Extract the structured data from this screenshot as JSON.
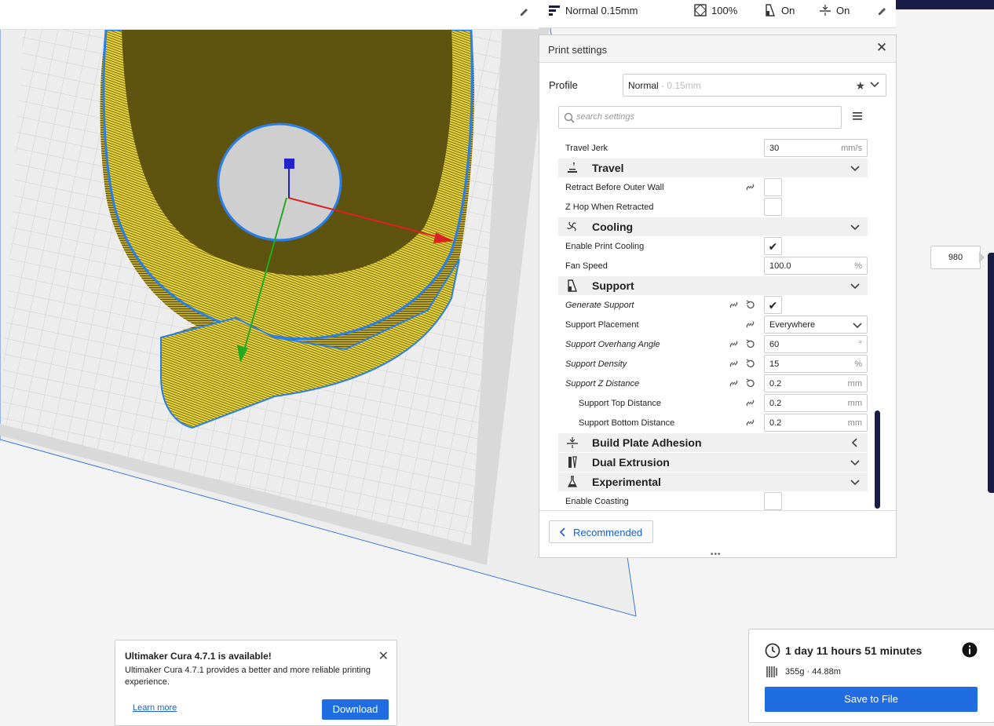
{
  "summary": {
    "profile": "Normal 0.15mm",
    "infill": "100%",
    "support": "On",
    "adhesion": "On"
  },
  "panel": {
    "title": "Print settings",
    "profile_label": "Profile",
    "profile_name": "Normal",
    "profile_sub": " - 0.15mm",
    "search_placeholder": "search settings",
    "recommended_label": "Recommended"
  },
  "settings": {
    "travel_jerk": {
      "label": "Travel Jerk",
      "value": "30",
      "unit": "mm/s"
    },
    "travel": {
      "label": "Travel"
    },
    "retract_outer": {
      "label": "Retract Before Outer Wall"
    },
    "zhop": {
      "label": "Z Hop When Retracted"
    },
    "cooling": {
      "label": "Cooling"
    },
    "enable_cooling": {
      "label": "Enable Print Cooling",
      "check": "✔"
    },
    "fan_speed": {
      "label": "Fan Speed",
      "value": "100.0",
      "unit": "%"
    },
    "support": {
      "label": "Support"
    },
    "generate_support": {
      "label": "Generate Support",
      "check": "✔"
    },
    "support_placement": {
      "label": "Support Placement",
      "value": "Everywhere"
    },
    "overhang_angle": {
      "label": "Support Overhang Angle",
      "value": "60",
      "unit": "°"
    },
    "support_density": {
      "label": "Support Density",
      "value": "15",
      "unit": "%"
    },
    "support_z": {
      "label": "Support Z Distance",
      "value": "0.2",
      "unit": "mm"
    },
    "support_top": {
      "label": "Support Top Distance",
      "value": "0.2",
      "unit": "mm"
    },
    "support_bottom": {
      "label": "Support Bottom Distance",
      "value": "0.2",
      "unit": "mm"
    },
    "adhesion": {
      "label": "Build Plate Adhesion"
    },
    "dual": {
      "label": "Dual Extrusion"
    },
    "experimental": {
      "label": "Experimental"
    },
    "coasting": {
      "label": "Enable Coasting"
    }
  },
  "layer_value": "980",
  "notification": {
    "title": "Ultimaker Cura 4.7.1 is available!",
    "body": "Ultimaker Cura 4.7.1 provides a better and more reliable printing experience.",
    "learn_more": "Learn more",
    "download": "Download"
  },
  "estimate": {
    "time": "1 day 11 hours 51 minutes",
    "material": "355g · 44.88m",
    "save": "Save to File"
  },
  "colors": {
    "accent": "#1f6de0",
    "navy": "#191c45",
    "model": "#e8d640",
    "outline": "#2a7ee8"
  }
}
